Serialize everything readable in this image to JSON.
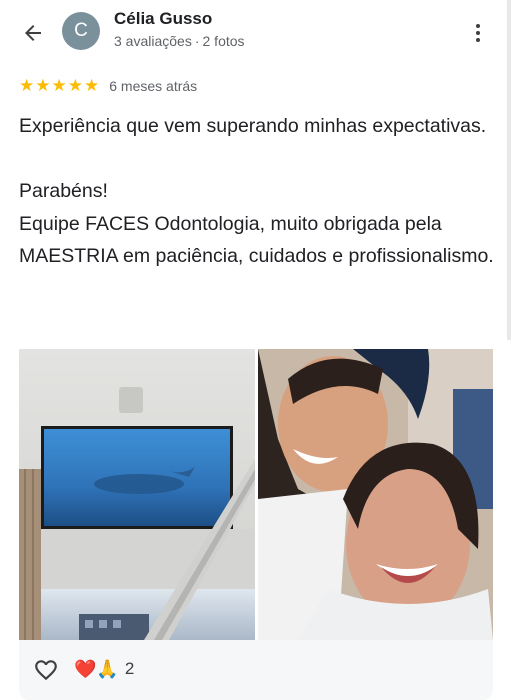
{
  "reviewer": {
    "avatar_initial": "C",
    "name": "Célia Gusso",
    "reviews_count": "3 avaliações",
    "separator": "·",
    "photos_count": "2 fotos"
  },
  "rating": {
    "stars": 5,
    "star_glyph": "★",
    "time_ago": "6 meses atrás",
    "star_color": "#fbbc04"
  },
  "review": {
    "paragraph_1": "Experiência que vem superando minhas expectativas.",
    "paragraph_2_line_1": "Parabéns!",
    "paragraph_2_line_2": "Equipe FACES Odontologia, muito obrigada pela MAESTRIA em paciência, cuidados e profissionalismo."
  },
  "photos": [
    {
      "icon": "ceiling-tv-photo"
    },
    {
      "icon": "selfie-photo"
    }
  ],
  "reactions": {
    "heart_emoji": "❤️",
    "pray_emoji": "🙏",
    "count": "2"
  }
}
